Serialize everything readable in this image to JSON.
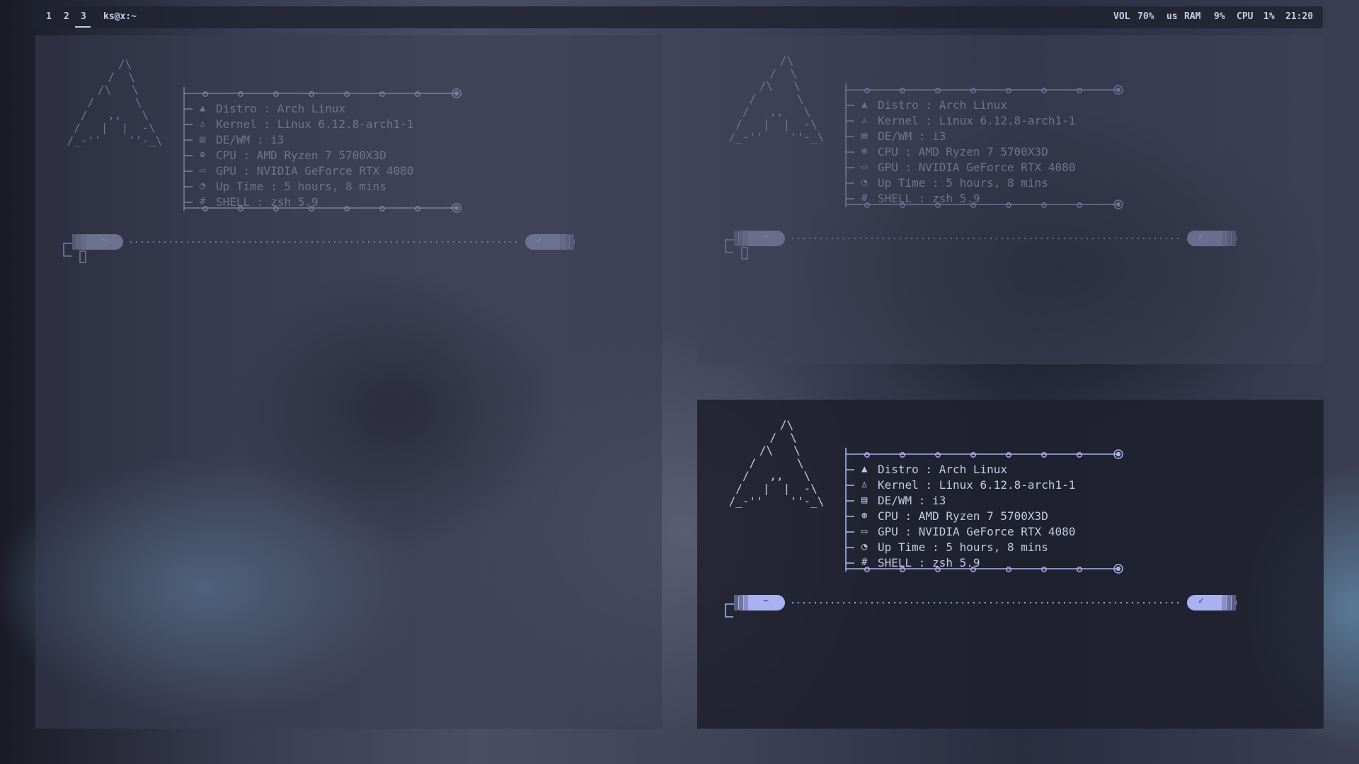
{
  "bar": {
    "workspaces": [
      "1",
      "2",
      "3"
    ],
    "active_workspace": "3",
    "window_title": "ks@x:~",
    "status": {
      "vol_label": "VOL",
      "vol_value": "70%",
      "layout": "us",
      "ram_label": "RAM",
      "ram_value": "9%",
      "cpu_label": "CPU",
      "cpu_value": "1%",
      "clock": "21:20"
    }
  },
  "ascii_logo": "   /\\\n  /  \\\n /\\   \\\n/      \\\n/   ,,   \\\n/   |  |  -\\\n/_-''    ''-_\\",
  "fetch": {
    "distro": "Distro : Arch Linux",
    "kernel": "Kernel : Linux 6.12.8-arch1-1",
    "dewm": "DE/WM : i3",
    "cpu": "CPU : AMD Ryzen 7 5700X3D",
    "gpu": "GPU : NVIDIA GeForce RTX 4080",
    "uptime": "Up Time : 5 hours, 8 mins",
    "shell": "SHELL : zsh 5.9"
  },
  "icons": {
    "distro": "arch-icon",
    "kernel": "tux-icon",
    "dewm": "window-icon",
    "cpu": "chip-icon",
    "gpu": "monitor-icon",
    "uptime": "clock-icon",
    "shell": "hash-icon"
  },
  "prompt": {
    "dir": "~",
    "status": "✓"
  },
  "colors": {
    "accent": "#a9b1f0",
    "bar_text": "#c9cde8"
  }
}
